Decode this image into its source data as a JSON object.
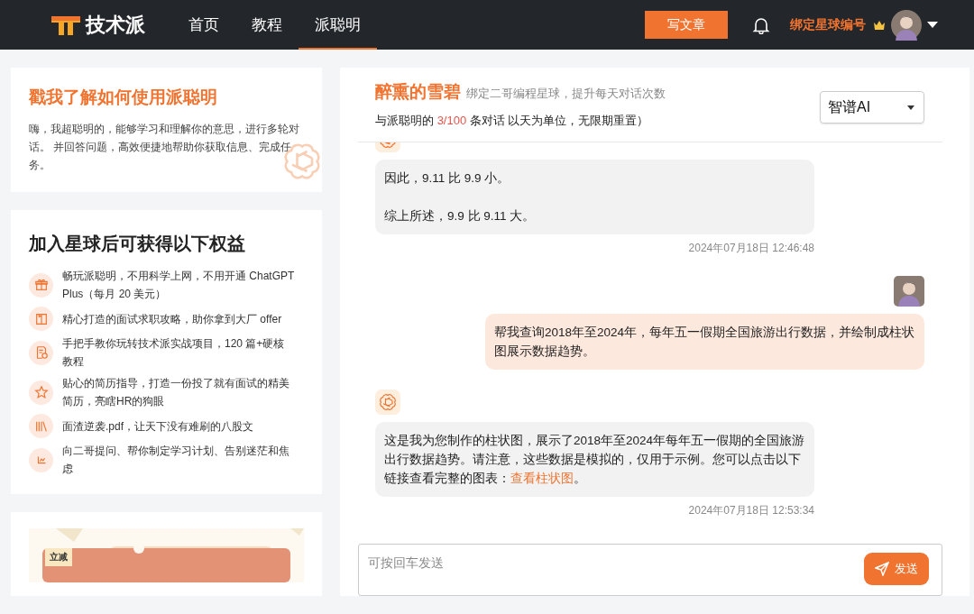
{
  "topbar": {
    "logo": "技术派",
    "nav": [
      {
        "label": "首页",
        "selected": false
      },
      {
        "label": "教程",
        "selected": false
      },
      {
        "label": "派聪明",
        "selected": true
      }
    ],
    "write_button": "写文章",
    "bind_link": "绑定星球编号"
  },
  "intro_card": {
    "title": "戳我了解如何使用派聪明",
    "text": "嗨，我超聪明的，能够学习和理解你的意思，进行多轮对话。 并回答问题，高效便捷地帮助你获取信息、完成任务。"
  },
  "benefits": {
    "title": "加入星球后可获得以下权益",
    "items": [
      {
        "kind": "gift",
        "text": "畅玩派聪明，不用科学上网，不用开通 ChatGPT Plus（每月 20 美元）"
      },
      {
        "kind": "book",
        "text": "精心打造的面试求职攻略，助你拿到大厂 offer"
      },
      {
        "kind": "doc",
        "text": "手把手教你玩转技术派实战项目，120 篇+硬核教程"
      },
      {
        "kind": "star",
        "text": "贴心的简历指导，打造一份投了就有面试的精美简历，亮瞎HR的狗眼"
      },
      {
        "kind": "books",
        "text": "面渣逆袭.pdf，让天下没有难刷的八股文"
      },
      {
        "kind": "chart",
        "text": "向二哥提问、帮你制定学习计划、告别迷茫和焦虑"
      }
    ]
  },
  "promo": {
    "tag": "立减"
  },
  "chat": {
    "user_name": "醉熏的雪碧",
    "hint": "绑定二哥编程星球，提升每天对话次数",
    "quota_prefix": "与派聪明的",
    "quota": "3/100",
    "quota_suffix": "条对话 以天为单位，无限期重置）",
    "model": "智谱AI",
    "messages": [
      {
        "kind": "bot",
        "paragraphs": [
          "因此，9.11 比 9.9 小。",
          "综上所述，9.9 比 9.11 大。"
        ],
        "time": "2024年07月18日 12:46:48"
      },
      {
        "kind": "user",
        "paragraphs": [
          "帮我查询2018年至2024年，每年五一假期全国旅游出行数据，并绘制成柱状图展示数据趋势。"
        ]
      },
      {
        "kind": "bot",
        "paragraphs": [
          "这是我为您制作的柱状图，展示了2018年至2024年每年五一假期的全国旅游出行数据趋势。请注意，这些数据是模拟的，仅用于示例。您可以点击以下链接查看完整的图表："
        ],
        "link": "查看柱状图",
        "after": "。",
        "time": "2024年07月18日 12:53:34"
      }
    ],
    "input_placeholder": "可按回车发送",
    "send_button": "发送"
  }
}
